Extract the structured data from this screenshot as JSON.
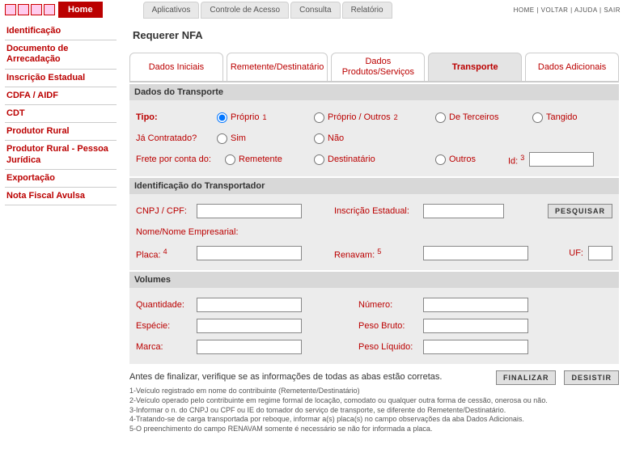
{
  "topbar": {
    "home": "Home",
    "nav": [
      "Aplicativos",
      "Controle de Acesso",
      "Consulta",
      "Relatório"
    ],
    "right": "HOME | VOLTAR | AJUDA | SAIR"
  },
  "sidebar": {
    "items": [
      "Identificação",
      "Documento de Arrecadação",
      "Inscrição Estadual",
      "CDFA / AIDF",
      "CDT",
      "Produtor Rural",
      "Produtor Rural - Pessoa Jurídica",
      "Exportação",
      "Nota Fiscal Avulsa"
    ]
  },
  "page": {
    "title": "Requerer NFA"
  },
  "tabs": [
    "Dados Iniciais",
    "Remetente/Destinatário",
    "Dados Produtos/Serviços",
    "Transporte",
    "Dados Adicionais"
  ],
  "transporte": {
    "section": "Dados do Transporte",
    "tipo_label": "Tipo:",
    "tipo_options": {
      "proprio": "Próprio",
      "proprio_outros": "Próprio / Outros",
      "terceiros": "De Terceiros",
      "tangido": "Tangido"
    },
    "tipo_sup1": "1",
    "tipo_sup2": "2",
    "contratado_label": "Já Contratado?",
    "contratado_options": {
      "sim": "Sim",
      "nao": "Não"
    },
    "frete_label": "Frete por conta do:",
    "frete_options": {
      "remetente": "Remetente",
      "destinatario": "Destinatário",
      "outros": "Outros"
    },
    "id_label": "Id:",
    "id_sup": "3"
  },
  "transportador": {
    "section": "Identificação do Transportador",
    "cnpj_label": "CNPJ / CPF:",
    "ie_label": "Inscrição Estadual:",
    "pesquisar": "PESQUISAR",
    "nome_label": "Nome/Nome Empresarial:",
    "placa_label": "Placa:",
    "placa_sup": "4",
    "renavam_label": "Renavam:",
    "renavam_sup": "5",
    "uf_label": "UF:"
  },
  "volumes": {
    "section": "Volumes",
    "quantidade": "Quantidade:",
    "especie": "Espécie:",
    "marca": "Marca:",
    "numero": "Número:",
    "peso_bruto": "Peso Bruto:",
    "peso_liquido": "Peso Líquido:"
  },
  "footer": {
    "msg": "Antes de finalizar, verifique se as informações de todas as abas estão corretas.",
    "finalizar": "FINALIZAR",
    "desistir": "DESISTIR",
    "notes": [
      "1-Veículo registrado em nome do contribuinte (Remetente/Destinatário)",
      "2-Veículo operado pelo contribuinte em regime formal de locação, comodato ou qualquer outra forma de cessão, onerosa ou não.",
      "3-Informar o n. do CNPJ ou CPF ou IE do tomador do serviço de transporte, se diferente do Remetente/Destinatário.",
      "4-Tratando-se de carga transportada por reboque, informar a(s) placa(s) no campo observações da aba Dados Adicionais.",
      "5-O preenchimento do campo RENAVAM somente é necessário se não for informada a placa."
    ]
  }
}
